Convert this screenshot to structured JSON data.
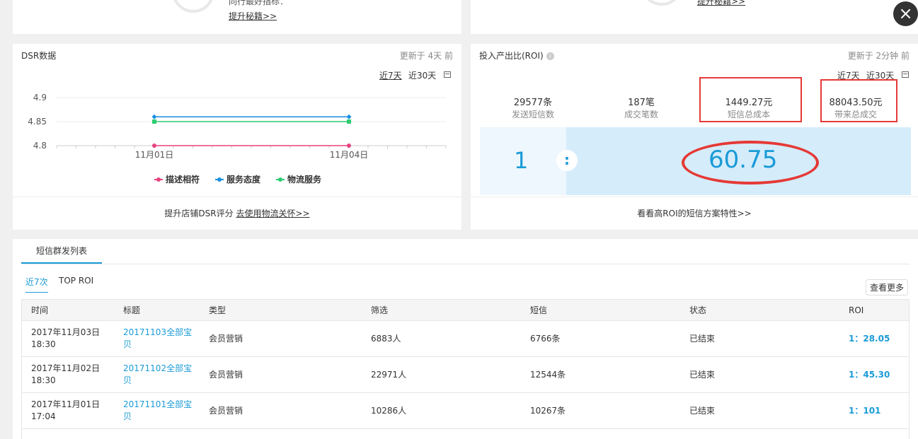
{
  "top": {
    "left_line": "同行最好指标：",
    "left_link": "提升秘籍>>",
    "right_link": "提升秘籍>>"
  },
  "dsr": {
    "title": "DSR数据",
    "updated": "更新于 4天 前",
    "range_7": "近7天",
    "range_30": "近30天",
    "footer_text": "提升店铺DSR评分",
    "footer_link": "去使用物流关怀>>"
  },
  "chart_data": {
    "type": "line",
    "x": [
      "11月01日",
      "11月04日"
    ],
    "y_ticks": [
      "4.9",
      "4.85",
      "4.8"
    ],
    "ylim": [
      4.8,
      4.9
    ],
    "series": [
      {
        "name": "描述相符",
        "values": [
          4.8,
          4.8
        ],
        "color": "#e8417e"
      },
      {
        "name": "服务态度",
        "values": [
          4.86,
          4.86
        ],
        "color": "#1a8fe0"
      },
      {
        "name": "物流服务",
        "values": [
          4.85,
          4.85
        ],
        "color": "#2ecc71"
      }
    ],
    "legend_position": "bottom"
  },
  "roi": {
    "title": "投入产出比(ROI)",
    "updated": "更新于 2分钟 前",
    "range_7": "近7天",
    "range_30": "近30天",
    "stats": [
      {
        "value": "29577条",
        "label": "发送短信数"
      },
      {
        "value": "187笔",
        "label": "成交笔数"
      },
      {
        "value": "1449.27元",
        "label": "短信总成本"
      },
      {
        "value": "88043.50元",
        "label": "带来总成交"
      }
    ],
    "ratio_left": "1",
    "ratio_sep": ":",
    "ratio_right": "60.75",
    "footer": "看看高ROI的短信方案特性>>"
  },
  "list": {
    "tab": "短信群发列表",
    "subtab_recent": "近7次",
    "subtab_top": "TOP ROI",
    "more": "查看更多",
    "headers": [
      "时间",
      "标题",
      "类型",
      "筛选",
      "短信",
      "状态",
      "ROI"
    ],
    "rows": [
      {
        "time": "2017年11月03日 18:30",
        "title": "20171103全部宝贝",
        "type": "会员营销",
        "filter": "6883人",
        "sms": "6766条",
        "status": "已结束",
        "roi": "1：28.05"
      },
      {
        "time": "2017年11月02日 18:30",
        "title": "20171102全部宝贝",
        "type": "会员营销",
        "filter": "22971人",
        "sms": "12544条",
        "status": "已结束",
        "roi": "1：45.30"
      },
      {
        "time": "2017年11月01日 17:04",
        "title": "20171101全部宝贝",
        "type": "会员营销",
        "filter": "10286人",
        "sms": "10267条",
        "status": "已结束",
        "roi": "1：101"
      }
    ]
  },
  "colors": {
    "accent": "#1a9bd7",
    "annotation": "#e53935"
  }
}
